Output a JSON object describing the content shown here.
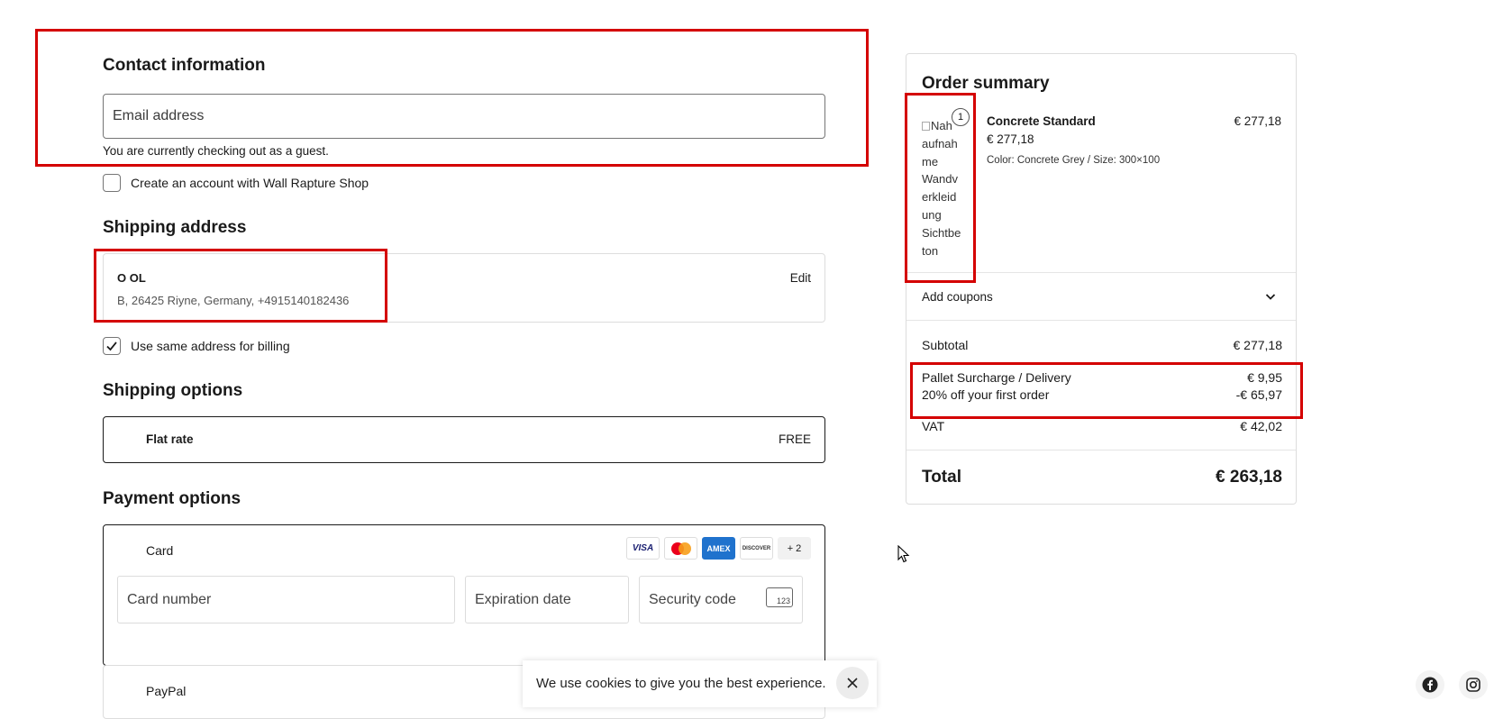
{
  "contact": {
    "title": "Contact information",
    "email_placeholder": "Email address",
    "guest_note": "You are currently checking out as a guest.",
    "create_account_label": "Create an account with Wall Rapture Shop"
  },
  "shipping_address": {
    "title": "Shipping address",
    "name": "O OL",
    "address": "B, 26425 Riyne, Germany, +4915140182436",
    "edit_label": "Edit",
    "billing_same_label": "Use same address for billing"
  },
  "shipping_options": {
    "title": "Shipping options",
    "method": "Flat rate",
    "price": "FREE"
  },
  "payment": {
    "title": "Payment options",
    "card_label": "Card",
    "card_logos": [
      "VISA",
      "mastercard",
      "AMEX",
      "DISCOVER"
    ],
    "more_label": "+ 2",
    "card_number_placeholder": "Card number",
    "expiration_placeholder": "Expiration date",
    "security_placeholder": "Security code",
    "security_icon_text": "123",
    "paypal_label": "PayPal"
  },
  "summary": {
    "title": "Order summary",
    "item": {
      "image_alt": "Nahaufnahme Wandverkleidung Sichtbeton",
      "image_alt_lines": [
        "Nah",
        "aufnah",
        "me",
        "Wandv",
        "erkleid",
        "ung",
        "Sichtbe",
        "ton"
      ],
      "quantity": "1",
      "name": "Concrete Standard",
      "unit_price": "€ 277,18",
      "line_price": "€ 277,18",
      "variant": "Color: Concrete Grey / Size: 300×100"
    },
    "coupons_label": "Add coupons",
    "subtotal_label": "Subtotal",
    "subtotal_value": "€ 277,18",
    "pallet_label": "Pallet Surcharge / Delivery",
    "pallet_value": "€ 9,95",
    "discount_label": "20% off your first order",
    "discount_value": "-€ 65,97",
    "vat_label": "VAT",
    "vat_value": "€ 42,02",
    "total_label": "Total",
    "total_value": "€ 263,18"
  },
  "cookie": {
    "message": "We use cookies to give you the best experience."
  },
  "social": [
    "facebook-icon",
    "instagram-icon"
  ],
  "colors": {
    "highlight": "#d40000",
    "text": "#1a1a1a",
    "amex": "#1f72cd"
  }
}
